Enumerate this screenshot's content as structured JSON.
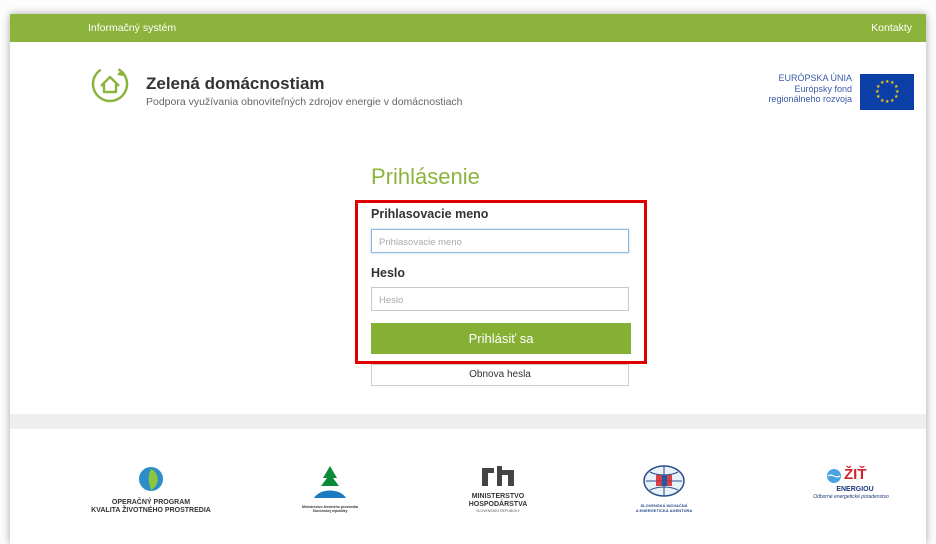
{
  "topbar": {
    "system_label": "Informačný systém",
    "contacts_label": "Kontakty"
  },
  "brand": {
    "title": "Zelená domácnostiam",
    "subtitle": "Podpora využívania obnoviteľných zdrojov energie v domácnostiach"
  },
  "eu": {
    "line1": "EURÓPSKA ÚNIA",
    "line2": "Európsky fond",
    "line3": "regionálneho rozvoja"
  },
  "login": {
    "title": "Prihlásenie",
    "username_label": "Prihlasovacie meno",
    "username_placeholder": "Prihlasovacie meno",
    "password_label": "Heslo",
    "password_placeholder": "Heslo",
    "submit_label": "Prihlásiť sa",
    "reset_label": "Obnova hesla"
  },
  "footer": {
    "op_line1": "OPERAČNÝ PROGRAM",
    "op_line2": "KVALITA ŽIVOTNÉHO PROSTREDIA",
    "ministry_env": "Ministerstvo životného prostredia Slovenskej republiky",
    "mh_line1": "MINISTERSTVO",
    "mh_line2": "HOSPODÁRSTVA",
    "mh_line3": "SLOVENSKEJ REPUBLIKY",
    "siea_line1": "SLOVENSKÁ INOVAČNÁ",
    "siea_line2": "A ENERGETICKÁ AGENTÚRA",
    "zit_line1": "ŽIŤ",
    "zit_line2": "ENERGIOU",
    "zit_line3": "Odborné energetické poradenstvo"
  },
  "colors": {
    "accent": "#8cb43c",
    "button": "#86b033",
    "highlight": "#e00000",
    "eu_blue": "#0c3fa6"
  }
}
